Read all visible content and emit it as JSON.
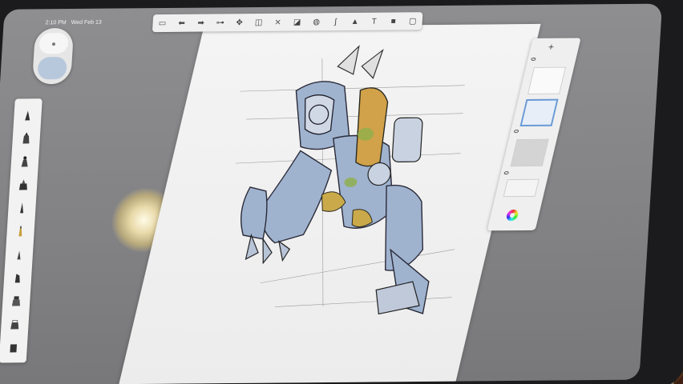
{
  "status_bar": {
    "time": "2:10 PM",
    "date": "Wed Feb 13"
  },
  "top_toolbar": {
    "icons": [
      "gallery-icon",
      "undo-icon",
      "redo-icon",
      "ruler-icon",
      "transform-icon",
      "layer-icon",
      "symmetry-icon",
      "fill-icon",
      "pen-icon",
      "image-icon",
      "text-icon",
      "camera-icon",
      "fullscreen-icon"
    ],
    "text_tool_label": "T"
  },
  "brush_palette": {
    "brushes": [
      "pencil",
      "marker",
      "brush",
      "airbrush",
      "ballpoint",
      "paintbrush",
      "fineliner",
      "chisel",
      "smudge",
      "eraser",
      "fill"
    ]
  },
  "layers_panel": {
    "add_label": "+",
    "layer_count": 4,
    "selected_layer": 2
  },
  "colors": {
    "accent_blue": "#6a9ad6",
    "puck_color": "#b7c8dc",
    "ui_panel": "#f0f0f0",
    "canvas_bg": "#868688"
  }
}
